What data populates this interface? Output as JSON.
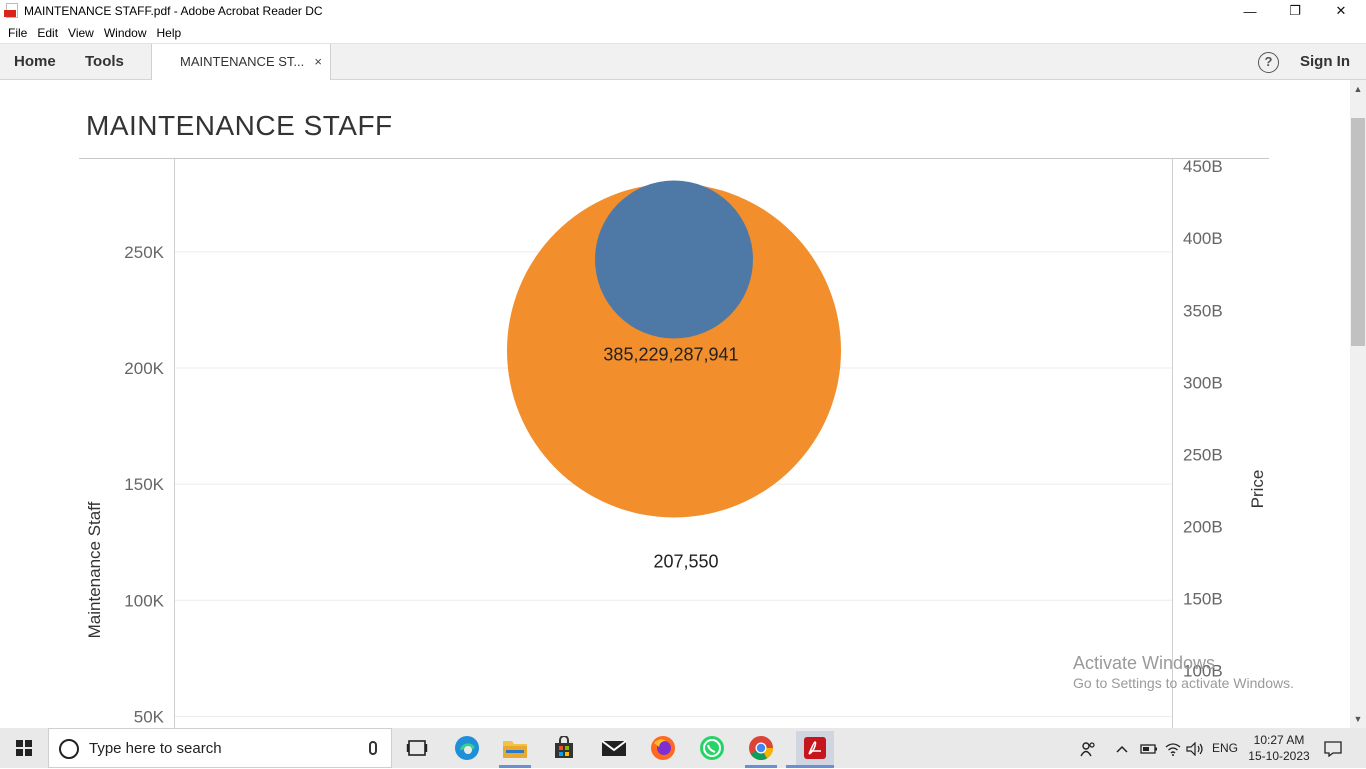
{
  "window": {
    "title": "MAINTENANCE STAFF.pdf - Adobe Acrobat Reader DC",
    "controls": {
      "minimize": "—",
      "restore": "❐",
      "close": "✕"
    }
  },
  "menu": {
    "items": [
      "File",
      "Edit",
      "View",
      "Window",
      "Help"
    ]
  },
  "tabs": {
    "home": "Home",
    "tools": "Tools",
    "document": "MAINTENANCE ST...",
    "close_symbol": "×",
    "help_symbol": "?",
    "sign_in": "Sign In"
  },
  "document": {
    "title": "MAINTENANCE STAFF"
  },
  "chart_data": {
    "type": "scatter",
    "title": "MAINTENANCE STAFF",
    "ylabel": "Maintenance Staff",
    "y2label": "Price",
    "y_ticks": [
      "250K",
      "200K",
      "150K",
      "100K",
      "50K"
    ],
    "y_tick_values": [
      250000,
      200000,
      150000,
      100000,
      50000
    ],
    "y2_ticks": [
      "450B",
      "400B",
      "350B",
      "300B",
      "250B",
      "200B",
      "150B",
      "100B"
    ],
    "y2_tick_values": [
      450,
      400,
      350,
      300,
      250,
      200,
      150,
      100
    ],
    "ylim": [
      45000,
      290000
    ],
    "y2lim": [
      60,
      455
    ],
    "grid": true,
    "series": [
      {
        "value": 207550,
        "label": "207,550",
        "axis": "left",
        "color": "#f28e2b"
      },
      {
        "value": 385229287941,
        "label": "385,229,287,941",
        "axis": "right",
        "color": "#4e79a7"
      }
    ]
  },
  "watermark": {
    "line1": "Activate Windows",
    "line2": "Go to Settings to activate Windows."
  },
  "taskbar": {
    "search_placeholder": "Type here to search",
    "language": "ENG",
    "time": "10:27 AM",
    "date": "15-10-2023"
  },
  "colors": {
    "orange": "#f28e2b",
    "blue": "#4e79a7",
    "acrobat_red": "#d9241c"
  }
}
